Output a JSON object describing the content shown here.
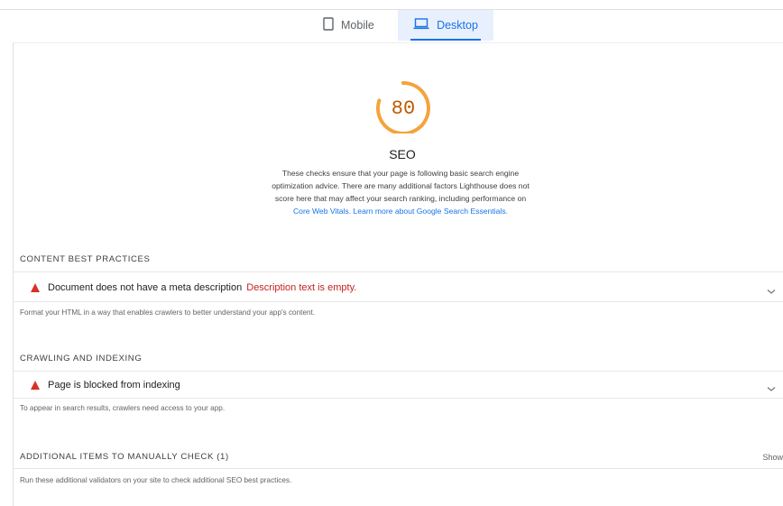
{
  "tabs": {
    "mobile": "Mobile",
    "desktop": "Desktop"
  },
  "gauge": {
    "score": "80",
    "title": "SEO",
    "color": "#f4a33c",
    "fraction": 0.8
  },
  "description": {
    "line1": "These checks ensure that your page is following basic search engine",
    "line2": "optimization advice. There are many additional factors Lighthouse does not",
    "line3": "score here that may affect your search ranking, including performance on",
    "link1": "Core Web Vitals",
    "sep": ". ",
    "link2": "Learn more about Google Search Essentials",
    "end": "."
  },
  "sections": {
    "content": {
      "title": "CONTENT BEST PRACTICES",
      "audit_title": "Document does not have a meta description",
      "audit_subtitle": "Description text is empty.",
      "note": "Format your HTML in a way that enables crawlers to better understand your app's content."
    },
    "crawling": {
      "title": "CRAWLING AND INDEXING",
      "audit_title": "Page is blocked from indexing",
      "note": "To appear in search results, crawlers need access to your app."
    },
    "manual": {
      "title": "ADDITIONAL ITEMS TO MANUALLY CHECK (1)",
      "show": "Show",
      "note": "Run these additional validators on your site to check additional SEO best practices."
    }
  },
  "colors": {
    "accent": "#1a73e8",
    "fail": "#d93025",
    "average": "#f4a33c"
  },
  "icons": {
    "mobile": "phone-icon",
    "desktop": "laptop-icon",
    "fail": "warning-triangle-icon",
    "expand": "chevron-down-icon"
  }
}
